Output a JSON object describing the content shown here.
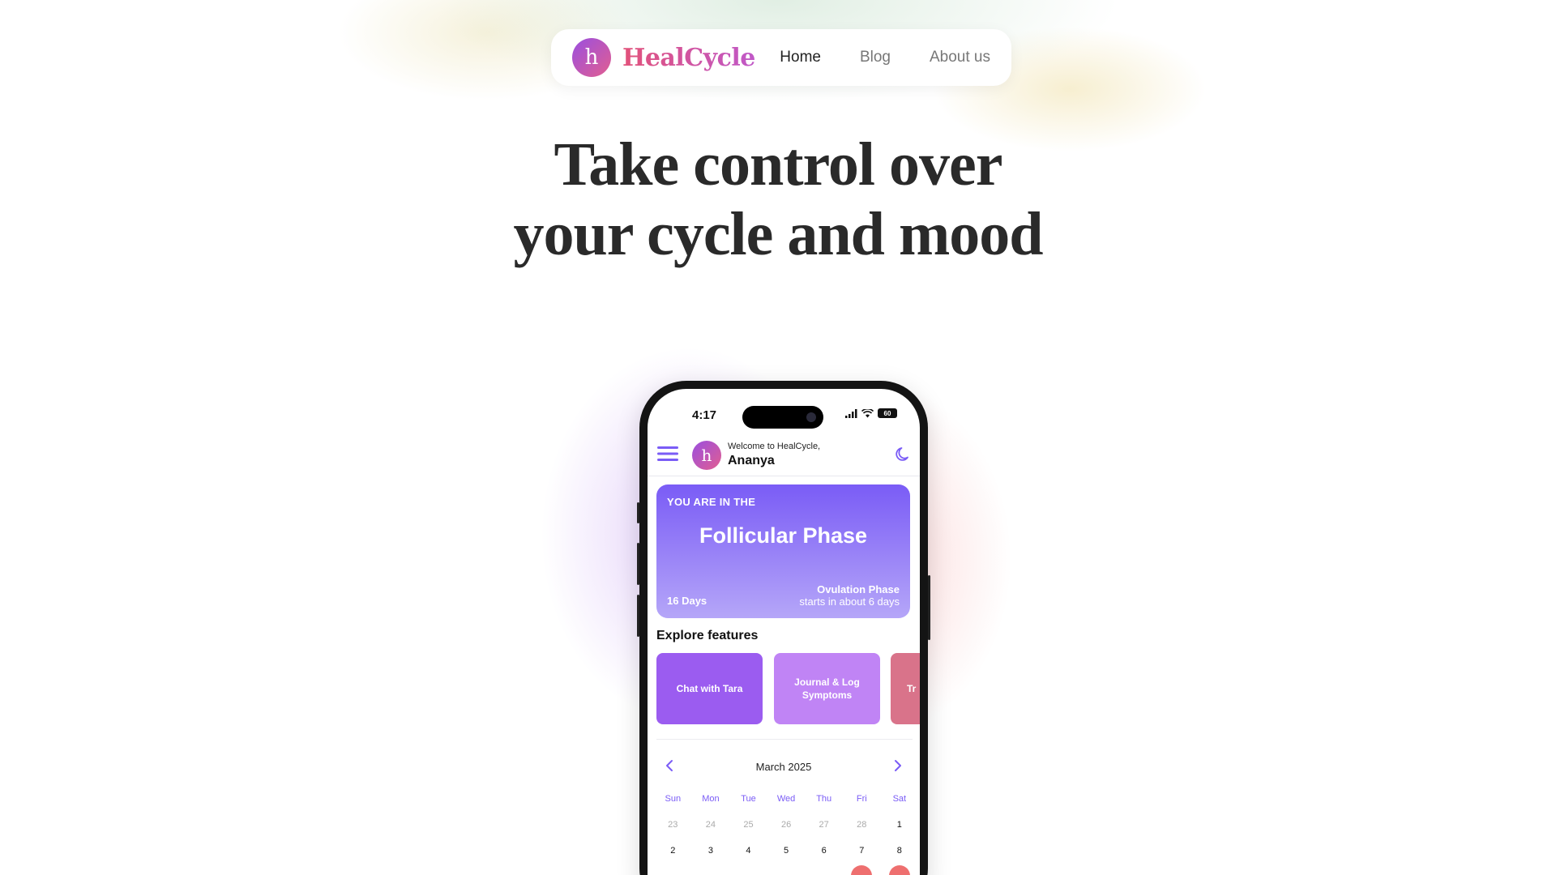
{
  "brand": {
    "initial": "h",
    "name": "HealCycle"
  },
  "nav": {
    "items": [
      {
        "label": "Home",
        "active": true
      },
      {
        "label": "Blog",
        "active": false
      },
      {
        "label": "About us",
        "active": false
      }
    ]
  },
  "hero": {
    "headline": "Take control over your cycle and mood"
  },
  "phone": {
    "status": {
      "time": "4:17",
      "battery": "60"
    },
    "header": {
      "avatar_initial": "h",
      "welcome": "Welcome to HealCycle,",
      "user": "Ananya"
    },
    "phase_card": {
      "kicker": "YOU ARE IN THE",
      "phase": "Follicular Phase",
      "days": "16 Days",
      "next_phase": "Ovulation Phase",
      "next_phase_sub": "starts in about 6 days"
    },
    "explore": {
      "title": "Explore features",
      "cards": [
        "Chat with Tara",
        "Journal & Log Symptoms",
        "Tr"
      ]
    },
    "calendar": {
      "month": "March 2025",
      "days_of_week": [
        "Sun",
        "Mon",
        "Tue",
        "Wed",
        "Thu",
        "Fri",
        "Sat"
      ],
      "week1": [
        "23",
        "24",
        "25",
        "26",
        "27",
        "28",
        "1"
      ],
      "week2": [
        "2",
        "3",
        "4",
        "5",
        "6",
        "7",
        "8"
      ]
    }
  },
  "colors": {
    "accent_purple": "#7a5cf6",
    "brand_pink": "#e2527a",
    "period_red": "#ee6f6f"
  }
}
